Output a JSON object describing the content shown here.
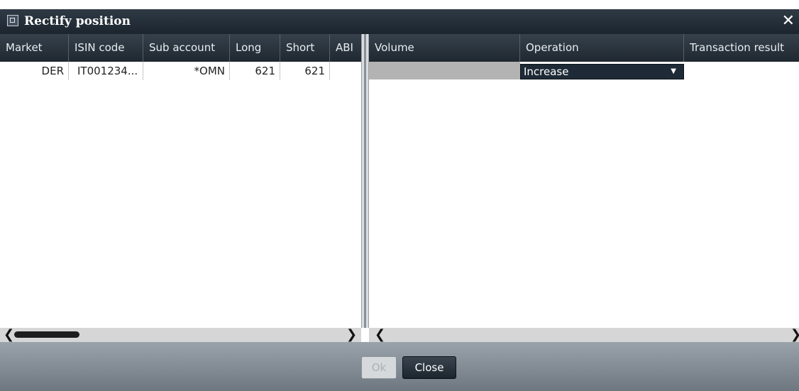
{
  "window": {
    "title": "Rectify position"
  },
  "left_table": {
    "columns": [
      "Market",
      "ISIN code",
      "Sub account",
      "Long",
      "Short",
      "ABI"
    ],
    "rows": [
      {
        "market": "DER",
        "isin": "IT001234...",
        "sub_account": "*OMN",
        "long": "621",
        "short": "621",
        "abi": ""
      }
    ]
  },
  "right_table": {
    "columns": [
      "Volume",
      "Operation",
      "Transaction result"
    ],
    "rows": [
      {
        "volume": "",
        "operation": "Increase",
        "result": ""
      }
    ]
  },
  "footer": {
    "ok_label": "Ok",
    "close_label": "Close"
  },
  "icons": {
    "close": "close-icon",
    "window": "window-icon",
    "dropdown": "chevron-down-icon"
  }
}
